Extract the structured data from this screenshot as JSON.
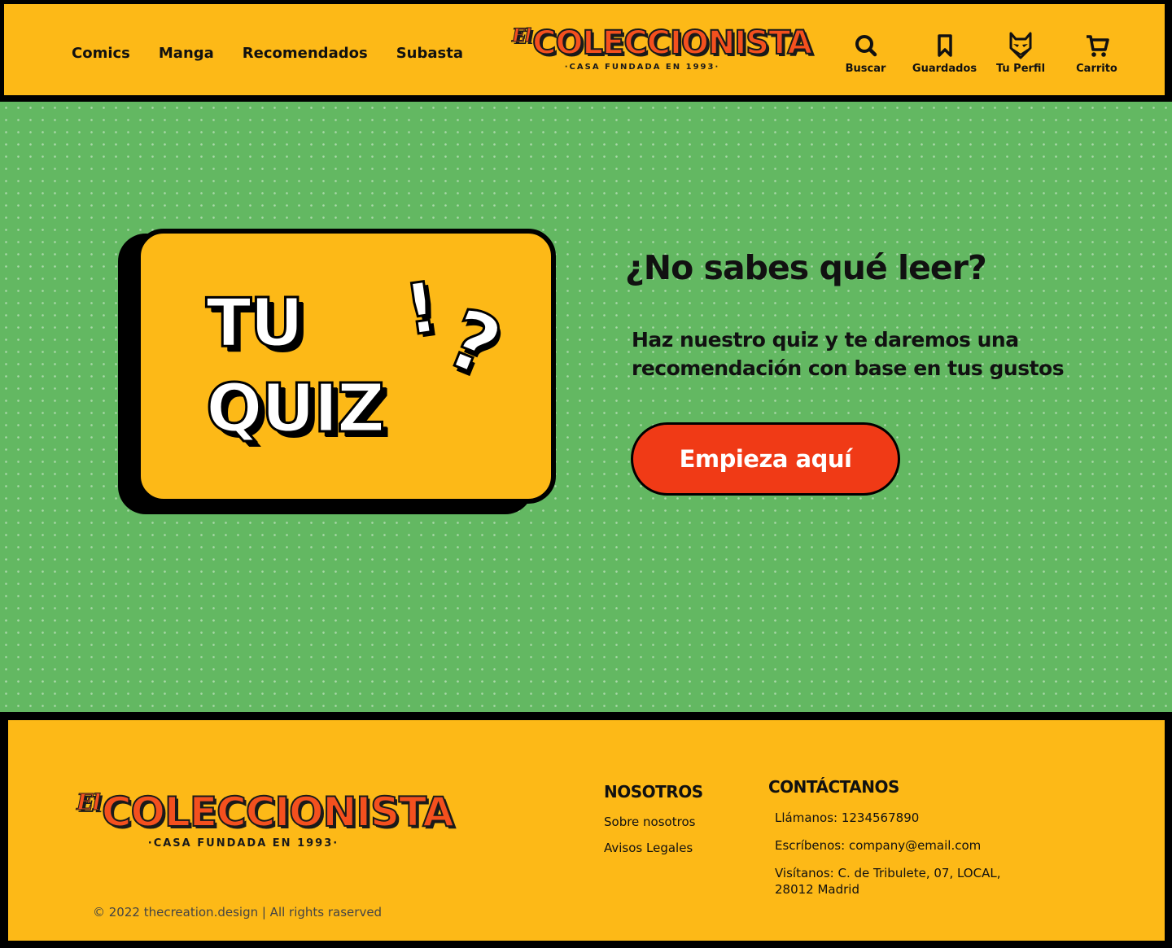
{
  "header": {
    "nav": [
      "Comics",
      "Manga",
      "Recomendados",
      "Subasta"
    ],
    "logo": {
      "prefix": "El",
      "name": "COLECCIONISTA",
      "tagline": "·CASA FUNDADA EN 1993·"
    },
    "actions": [
      {
        "label": "Buscar",
        "icon": "search-icon"
      },
      {
        "label": "Guardados",
        "icon": "bookmark-icon"
      },
      {
        "label": "Tu Perfil",
        "icon": "hero-mask-icon"
      },
      {
        "label": "Carrito",
        "icon": "cart-icon"
      }
    ]
  },
  "hero": {
    "quiz_card": {
      "line1": "TU",
      "line2": "QUIZ",
      "exclamation": "!",
      "question": "?"
    },
    "title": "¿No sabes qué leer?",
    "description": "Haz nuestro quiz y te daremos una recomendación con base en tus gustos",
    "cta_label": "Empieza aquí"
  },
  "footer": {
    "logo": {
      "prefix": "El",
      "name": "COLECCIONISTA",
      "tagline": "·CASA FUNDADA EN 1993·"
    },
    "copyright": "© 2022 thecreation.design | All rights raserved",
    "nosotros": {
      "title": "NOSOTROS",
      "links": [
        "Sobre nosotros",
        "Avisos Legales"
      ]
    },
    "contacto": {
      "title": "CONTÁCTANOS",
      "phone": "Llámanos: 1234567890",
      "email": "Escríbenos: company@email.com",
      "address": "Visítanos: C. de Tribulete, 07, LOCAL, 28012 Madrid"
    }
  },
  "colors": {
    "yellow": "#FDB917",
    "green": "#63B862",
    "red": "#F03A16",
    "logo_orange": "#F4501E",
    "black": "#000000"
  }
}
